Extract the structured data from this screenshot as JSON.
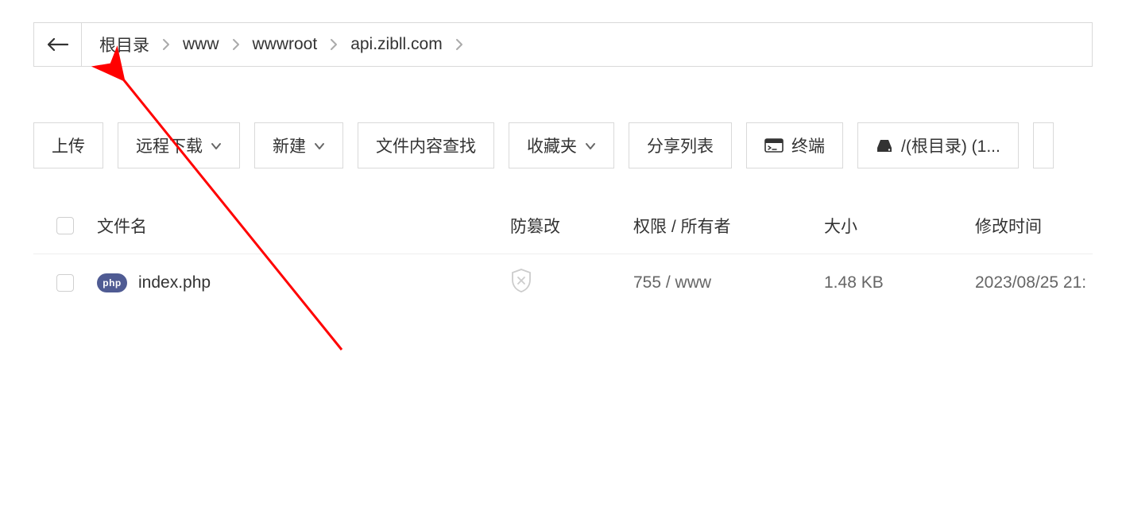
{
  "breadcrumb": {
    "items": [
      "根目录",
      "www",
      "wwwroot",
      "api.zibll.com"
    ]
  },
  "toolbar": {
    "upload": "上传",
    "remote_download": "远程下载",
    "new": "新建",
    "content_search": "文件内容查找",
    "favorites": "收藏夹",
    "share_list": "分享列表",
    "terminal": "终端",
    "disk": "/(根目录) (1..."
  },
  "table": {
    "headers": {
      "name": "文件名",
      "tamper": "防篡改",
      "perm": "权限 / 所有者",
      "size": "大小",
      "mtime": "修改时间"
    },
    "rows": [
      {
        "icon_label": "php",
        "name": "index.php",
        "permission": "755 / www",
        "size": "1.48 KB",
        "mtime": "2023/08/25 21:"
      }
    ]
  }
}
